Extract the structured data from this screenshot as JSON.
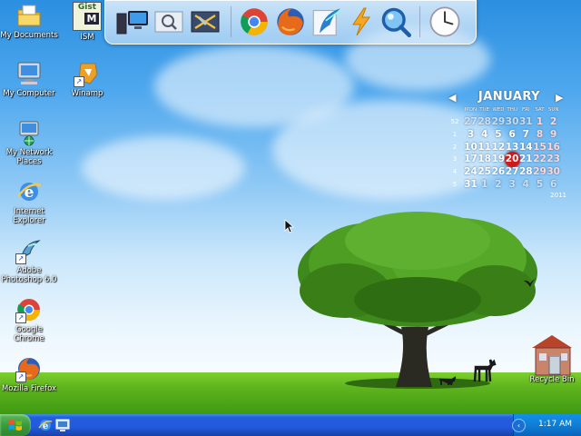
{
  "desktop_icons": [
    {
      "label": "My Documents",
      "icon": "my-documents-icon"
    },
    {
      "label": "ISM",
      "icon": "ism-icon"
    },
    {
      "label": "My Computer",
      "icon": "my-computer-icon"
    },
    {
      "label": "Winamp",
      "icon": "winamp-icon"
    },
    {
      "label": "My Network Places",
      "icon": "network-places-icon"
    },
    {
      "label": "Internet Explorer",
      "icon": "internet-explorer-icon"
    },
    {
      "label": "Adobe Photoshop 6.0",
      "icon": "photoshop-icon"
    },
    {
      "label": "Google Chrome",
      "icon": "chrome-icon"
    },
    {
      "label": "Mozilla Firefox",
      "icon": "firefox-icon"
    },
    {
      "label": "Recycle Bin",
      "icon": "recycle-bin-icon"
    }
  ],
  "ism_text": {
    "top": "Gist",
    "bottom": "M"
  },
  "dock": {
    "items": [
      "my-computer-icon",
      "search-files-icon",
      "control-panel-icon",
      "chrome-icon",
      "firefox-icon",
      "feather-icon",
      "lightning-icon",
      "magnifier-icon",
      "clock-icon"
    ]
  },
  "calendar": {
    "month": "JANUARY",
    "year": "2011",
    "days_of_week": [
      "MON",
      "TUE",
      "WED",
      "THU",
      "FRI",
      "SAT",
      "SUN"
    ],
    "week_numbers": [
      "52",
      "1",
      "2",
      "3",
      "4",
      "5"
    ],
    "weeks": [
      [
        "27",
        "28",
        "29",
        "30",
        "31",
        "1",
        "2"
      ],
      [
        "3",
        "4",
        "5",
        "6",
        "7",
        "8",
        "9"
      ],
      [
        "10",
        "11",
        "12",
        "13",
        "14",
        "15",
        "16"
      ],
      [
        "17",
        "18",
        "19",
        "20",
        "21",
        "22",
        "23"
      ],
      [
        "24",
        "25",
        "26",
        "27",
        "28",
        "29",
        "30"
      ],
      [
        "31",
        "1",
        "2",
        "3",
        "4",
        "5",
        "6"
      ]
    ],
    "today": "20"
  },
  "taskbar": {
    "clock": "1:17 AM",
    "quick_launch": [
      "internet-explorer-icon",
      "show-desktop-icon"
    ]
  },
  "colors": {
    "taskbar_blue": "#245edb",
    "start_green": "#3c9b3c",
    "today_red": "#d21818"
  }
}
